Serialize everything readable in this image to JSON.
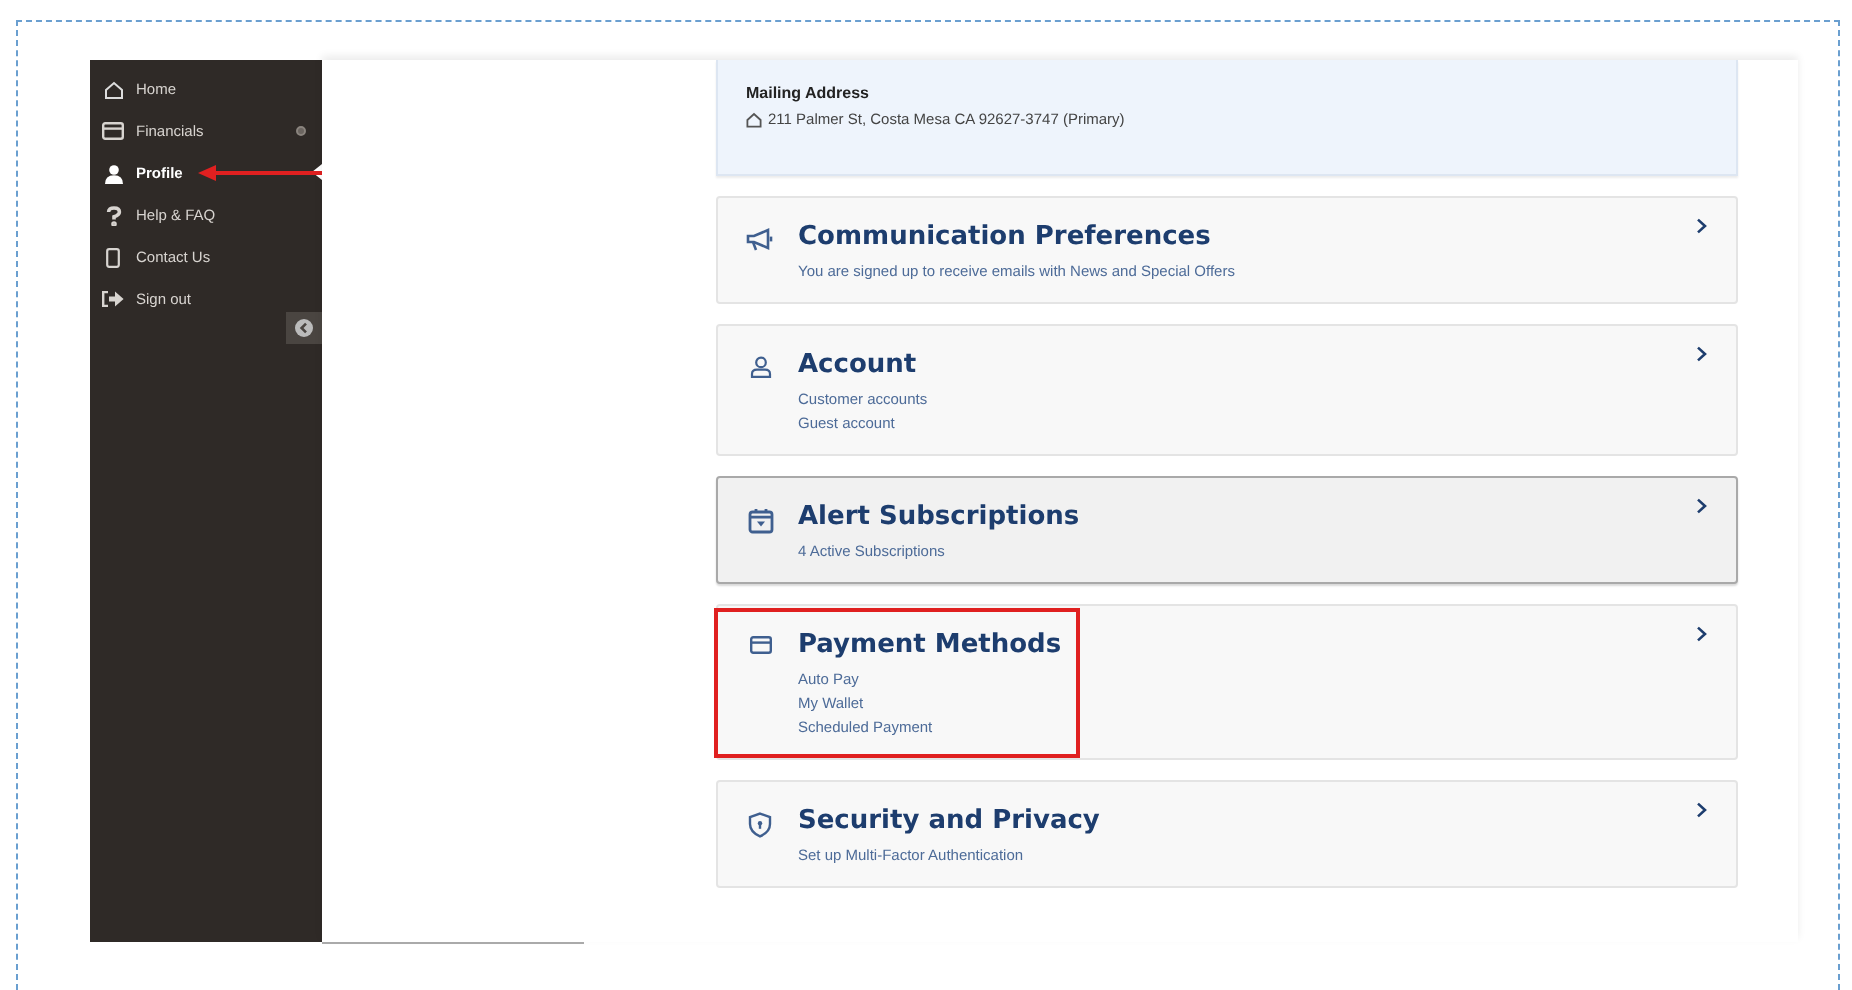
{
  "sidebar": {
    "items": [
      {
        "kind": "home",
        "label": "Home",
        "selected": false,
        "expandable": false
      },
      {
        "kind": "card",
        "label": "Financials",
        "selected": false,
        "expandable": true
      },
      {
        "kind": "person",
        "label": "Profile",
        "selected": true,
        "expandable": false
      },
      {
        "kind": "question",
        "label": "Help & FAQ",
        "selected": false,
        "expandable": false
      },
      {
        "kind": "phone",
        "label": "Contact Us",
        "selected": false,
        "expandable": false
      },
      {
        "kind": "signout",
        "label": "Sign out",
        "selected": false,
        "expandable": false
      }
    ]
  },
  "address": {
    "heading": "Mailing Address",
    "line": "211 Palmer St, Costa Mesa CA 92627-3747 (Primary)"
  },
  "cards": [
    {
      "kind": "megaphone",
      "title": "Communication Preferences",
      "lines": [
        "You are signed up to receive emails with News and Special Offers"
      ],
      "selected": false,
      "highlighted": false
    },
    {
      "kind": "person",
      "title": "Account",
      "lines": [
        "Customer accounts",
        "Guest account"
      ],
      "selected": false,
      "highlighted": false
    },
    {
      "kind": "calendar",
      "title": "Alert Subscriptions",
      "lines": [
        "4 Active Subscriptions"
      ],
      "selected": true,
      "highlighted": false
    },
    {
      "kind": "card",
      "title": "Payment Methods",
      "lines": [
        "Auto Pay",
        "My Wallet",
        "Scheduled Payment"
      ],
      "selected": false,
      "highlighted": true
    },
    {
      "kind": "shield",
      "title": "Security and Privacy",
      "lines": [
        "Set up Multi-Factor Authentication"
      ],
      "selected": false,
      "highlighted": false
    }
  ]
}
